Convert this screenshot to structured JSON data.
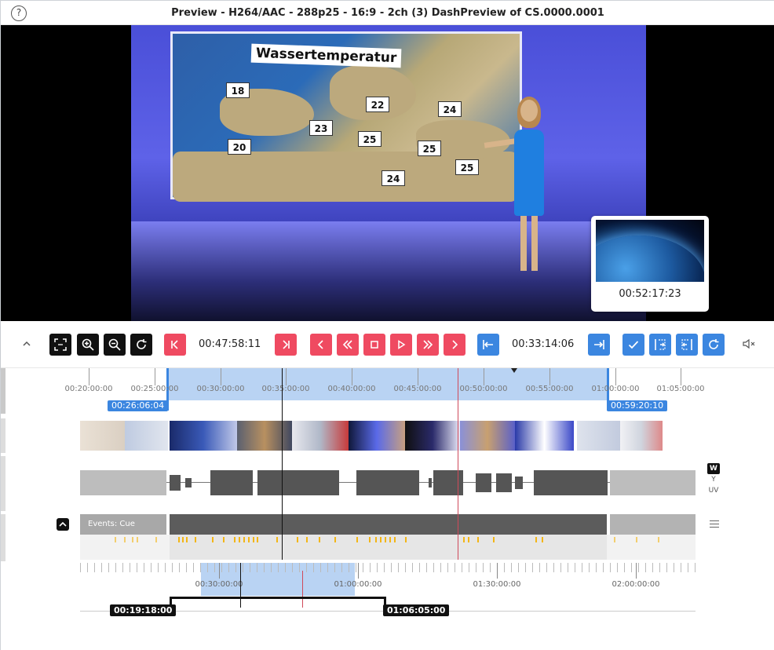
{
  "window": {
    "title": "Preview - H264/AAC - 288p25 - 16:9 - 2ch (3) DashPreview of CS.0000.0001"
  },
  "video": {
    "screen_title": "Wassertemperatur",
    "temperatures": [
      "18",
      "22",
      "24",
      "23",
      "25",
      "25",
      "20",
      "25",
      "24"
    ],
    "hover_preview_time": "00:52:17:23"
  },
  "controls": {
    "current_time": "00:47:58:11",
    "duration": "00:33:14:06"
  },
  "timeline": {
    "ruler_labels": [
      "00:20:00:00",
      "00:25:00:00",
      "00:30:00:00",
      "00:35:00:00",
      "00:40:00:00",
      "00:45:00:00",
      "00:50:00:00",
      "00:55:00:00",
      "01:00:00:00",
      "01:05:00:00"
    ],
    "in_point": "00:26:06:04",
    "out_point": "00:59:20:10",
    "waveform_modes": [
      "W",
      "Y",
      "UV"
    ],
    "events_label": "Events: Cue",
    "overview_labels": [
      "00:30:00:00",
      "01:00:00:00",
      "01:30:00:00",
      "02:00:00:00"
    ],
    "overview_start": "00:19:18:00",
    "overview_end": "01:06:05:00"
  },
  "colors": {
    "accent_blue": "#3b86e0",
    "accent_red": "#ef4a61",
    "cue_yellow": "#f3b616"
  }
}
